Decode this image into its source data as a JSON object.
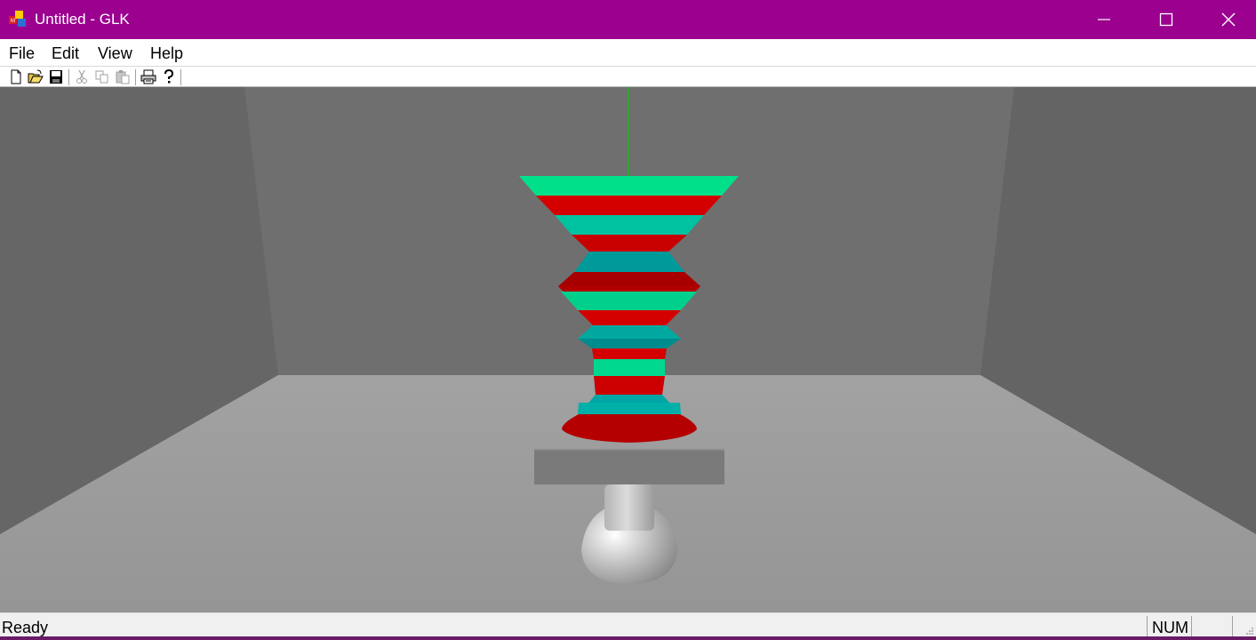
{
  "window": {
    "title": "Untitled - GLK",
    "app_icon": "mfc-app-icon",
    "controls": [
      "minimize-icon",
      "maximize-icon",
      "close-icon"
    ],
    "titlebar_color": "#9b008f"
  },
  "menu": {
    "file": "File",
    "edit": "Edit",
    "view": "View",
    "help": "Help"
  },
  "toolbar": {
    "buttons": [
      "new-file-icon",
      "open-folder-icon",
      "save-disk-icon",
      "cut-icon",
      "copy-icon",
      "paste-icon",
      "print-icon",
      "help-icon"
    ],
    "disabled": [
      "cut-icon",
      "copy-icon",
      "paste-icon"
    ]
  },
  "scene": {
    "description_colors": {
      "stripe_red": "#d40000",
      "stripe_teal": "#009a9a",
      "stripe_green": "#00e08a",
      "axis_line": "#00d000",
      "room_floor": "#9c9c9c",
      "room_back_wall": "#6e6e6e"
    }
  },
  "status": {
    "text": "Ready",
    "num": "NUM"
  }
}
